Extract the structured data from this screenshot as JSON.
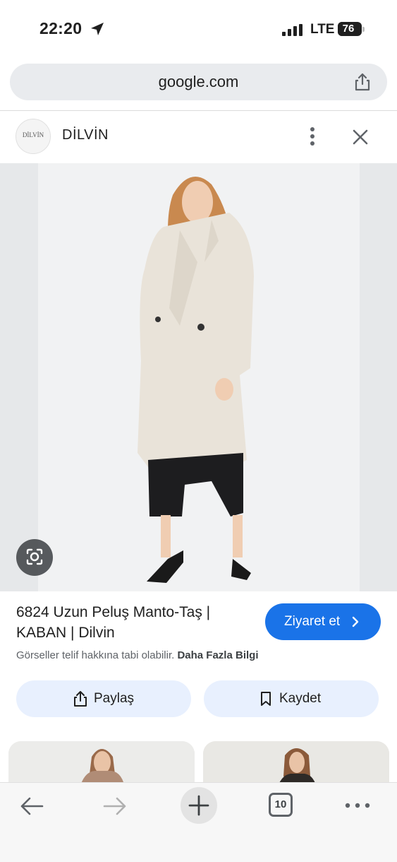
{
  "status_bar": {
    "time": "22:20",
    "network": "LTE",
    "battery": "76"
  },
  "url_bar": {
    "url": "google.com"
  },
  "source": {
    "logo_text": "DİLVİN",
    "name": "DİLVİN"
  },
  "result": {
    "title": "6824 Uzun Peluş Manto-Taş | KABAN | Dilvin",
    "visit_label": "Ziyaret et",
    "copyright_text": "Görseller telif hakkına tabi olabilir.",
    "more_info_link": "Daha Fazla Bilgi"
  },
  "actions": {
    "share_label": "Paylaş",
    "save_label": "Kaydet"
  },
  "toolbar": {
    "tab_count": "10"
  },
  "colors": {
    "accent": "#1a73e8",
    "chip_bg": "#e8f0fe",
    "url_bar_bg": "#e9ebee"
  },
  "icons": [
    "location-arrow-icon",
    "signal-icon",
    "share-icon",
    "more-vert-icon",
    "close-icon",
    "lens-icon",
    "chevron-right-icon",
    "bookmark-icon",
    "back-arrow-icon",
    "forward-arrow-icon",
    "plus-icon",
    "tabs-icon",
    "more-horiz-icon"
  ]
}
